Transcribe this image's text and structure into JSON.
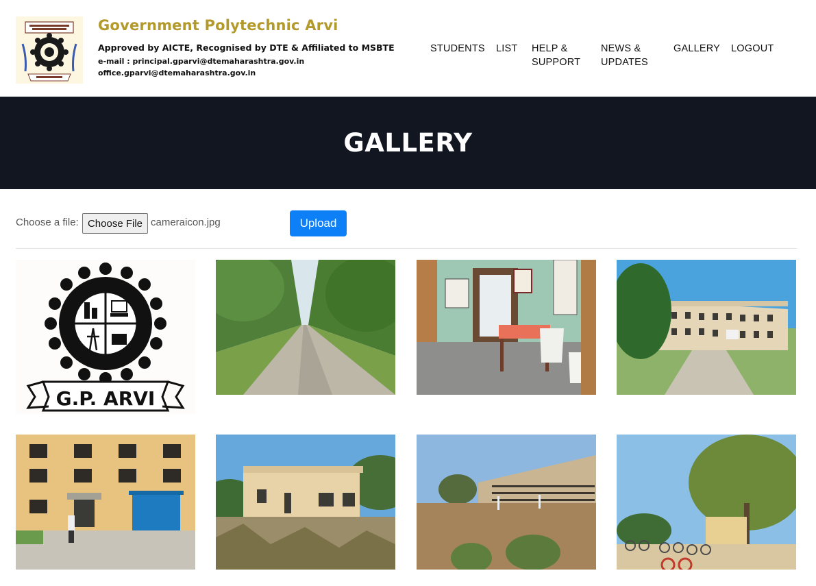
{
  "header": {
    "org_name": "Government Polytechnic Arvi",
    "approval": "Approved by AICTE, Recognised by DTE & Affiliated to MSBTE",
    "email_line1": "e-mail : principal.gparvi@dtemaharashtra.gov.in",
    "email_line2": "office.gparvi@dtemaharashtra.gov.in"
  },
  "nav": {
    "students": "STUDENTS",
    "list": "LIST",
    "help": "HELP & SUPPORT",
    "news": "NEWS & UPDATES",
    "gallery": "GALLERY",
    "logout": "LOGOUT"
  },
  "banner": {
    "title": "GALLERY"
  },
  "upload": {
    "label": "Choose a file:",
    "choose_button": "Choose File",
    "file_name": "cameraicon.jpg",
    "upload_button": "Upload"
  },
  "gallery": {
    "items": [
      {
        "subject": "G.P. ARVI",
        "kind": "college-logo"
      },
      {
        "kind": "tree-lined-road-photo"
      },
      {
        "kind": "office-interior-photo"
      },
      {
        "kind": "college-building-photo"
      },
      {
        "kind": "building-entrance-photo"
      },
      {
        "kind": "single-storey-building-photo"
      },
      {
        "kind": "campus-ground-photo"
      },
      {
        "kind": "bicycle-parking-photo"
      }
    ]
  },
  "colors": {
    "org_name": "#b39a2c",
    "banner_bg": "#111621",
    "upload_button": "#0d7ff7"
  }
}
